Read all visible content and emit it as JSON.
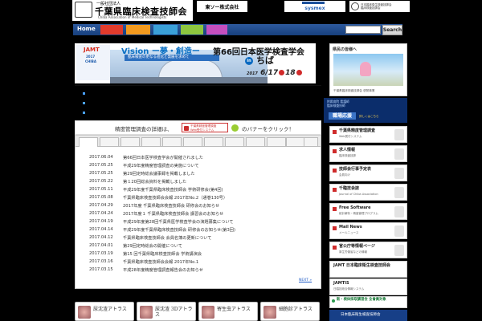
{
  "header": {
    "logo_sub": "一般社団法人",
    "logo_name": "千葉県臨床検査技師会",
    "logo_en": "Chiba Association of Medical Technologists",
    "sponsor_tosoh": "東ソー株式会社",
    "sponsor_sysmex": "sysmex",
    "sponsor_third_line1": "日本臨床衛生検査技師会",
    "sponsor_third_line2": "臨床検査技師会"
  },
  "nav": {
    "home": "Home",
    "badges": [
      "",
      "",
      "",
      "",
      ""
    ],
    "search_placeholder": "",
    "search_button": "Search"
  },
  "banner": {
    "jamt": "JAMT",
    "jamt_year": "2017",
    "jamt_city": "CHIBA",
    "vision": "Vision ー夢・創造ー",
    "tagline": "臨床検査の更なる進化と発展を求めて",
    "title": "第66回日本医学検査学会",
    "in": "in",
    "city": "ちば",
    "year": "2017",
    "date_from": "6/17",
    "date_to": "18"
  },
  "dark_links": [
    "",
    "",
    ""
  ],
  "notice": {
    "text_before": "精度管理調査の詳細は、",
    "banner_line1": "千葉県精度管理調査",
    "banner_line2": "Web受付システム",
    "text_after": "のバナーをクリック！"
  },
  "news": {
    "tabs": [
      "",
      "",
      "",
      "",
      "",
      "",
      "",
      "",
      "",
      "",
      "",
      ""
    ],
    "items": [
      {
        "date": "2017.06.04",
        "title": "第66回日本医学検査学会が開催されました"
      },
      {
        "date": "2017.05.25",
        "title": "平成29年度精度管理調査の実施について"
      },
      {
        "date": "2017.05.25",
        "title": "第29回定時総会議事録を掲載しました"
      },
      {
        "date": "2017.05.22",
        "title": "第１20回総会資料を掲載しました"
      },
      {
        "date": "2017.05.11",
        "title": "平成29年度千葉県臨床検査技師会 学術研修会(第4回)"
      },
      {
        "date": "2017.05.08",
        "title": "千葉県臨床検査技師会会報 2017年No.2（通巻130号）"
      },
      {
        "date": "2017.04.29",
        "title": "2017年度 千葉県臨床検査技師会 研修会のお知らせ"
      },
      {
        "date": "2017.04.24",
        "title": "2017年度１ 千葉県臨床検査技師会 講習会のお知らせ"
      },
      {
        "date": "2017.04.19",
        "title": "平成29年度第28回千葉県医学検査学会の演題募集について"
      },
      {
        "date": "2017.04.14",
        "title": "平成29年度千葉県臨床検査技師会 研修会のお知らせ(第3回)"
      },
      {
        "date": "2017.04.12",
        "title": "千葉県臨床検査技師会 会員名簿の更新について"
      },
      {
        "date": "2017.04.01",
        "title": "第29回定時総会の開催について"
      },
      {
        "date": "2017.03.19",
        "title": "第15 回千葉県臨床検査技師会 学術講演会"
      },
      {
        "date": "2017.03.16",
        "title": "千葉県臨床検査技師会会報 2017年No.1"
      },
      {
        "date": "2017.03.15",
        "title": "平成28年度精度管理調査報告会のお知らせ"
      }
    ],
    "next": "NEXT »"
  },
  "atlas": [
    {
      "label": "尿沈渣アトラス"
    },
    {
      "label": "尿沈渣 3Dアトラス"
    },
    {
      "label": "寄生虫アトラス"
    },
    {
      "label": "細胞診アトラス"
    }
  ],
  "right": {
    "citizen_head": "県民の皆様へ",
    "citizen_caption": "千葉県臨床検査技師会 啓発事業",
    "ad_line1": "附属病院 看護師",
    "ad_line2": "臨床検査技師",
    "ad_badge": "職場応援",
    "ad_sub": "詳しくはこちら",
    "links": [
      {
        "title": "千葉県精度管理調査",
        "sub": "Web受付システム"
      },
      {
        "title": "求人情報",
        "sub": "臨床検査技師"
      },
      {
        "title": "技師会行事予定表",
        "sub": "会員向け"
      },
      {
        "title": "千臨技会誌",
        "sub": "Journal of Chiba Association"
      },
      {
        "title": "Free Software",
        "sub": "統計解析・精度管理プログラム"
      },
      {
        "title": "Mail News",
        "sub": "メールニュース"
      },
      {
        "title": "官公庁等情報ページ",
        "sub": "厚生労働省などの情報"
      },
      {
        "title": "JAMT 日本臨床衛生検査技師会",
        "sub": ""
      },
      {
        "title": "JAMTIS",
        "sub": "日臨技総合情報システム"
      }
    ],
    "green": "新・検体採取講習会 全會員対象",
    "last": "日本臨床衛生検査技師会"
  }
}
